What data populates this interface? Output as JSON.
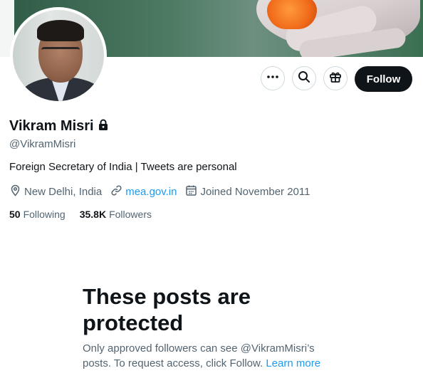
{
  "profile": {
    "name": "Vikram Misri",
    "handle": "@VikramMisri",
    "bio": "Foreign Secretary of India | Tweets are personal",
    "location": "New Delhi, India",
    "website": "mea.gov.in",
    "joined": "Joined November 2011",
    "following_count": "50",
    "following_label": "Following",
    "followers_count": "35.8K",
    "followers_label": "Followers"
  },
  "actions": {
    "more_icon": "more-icon",
    "search_icon": "search-icon",
    "gift_icon": "gift-icon",
    "follow_label": "Follow"
  },
  "protected": {
    "title": "These posts are protected",
    "body": "Only approved followers can see @VikramMisri’s posts. To request access, click Follow.",
    "learn_more": "Learn more"
  },
  "colors": {
    "accent": "#1d9bf0",
    "text_primary": "#0f1419",
    "text_secondary": "#536471"
  }
}
